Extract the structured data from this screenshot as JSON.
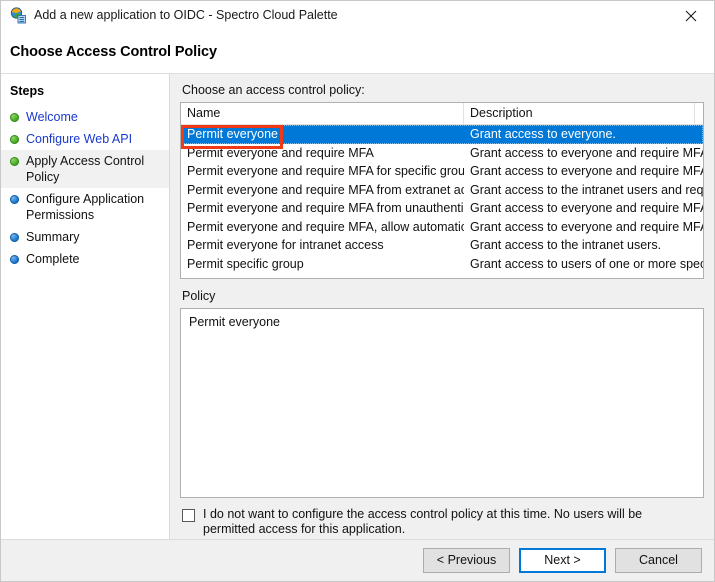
{
  "window": {
    "title": "Add a new application to OIDC - Spectro Cloud Palette",
    "icon": "adfs-wizard-globe-icon",
    "close_label": "×"
  },
  "header": {
    "heading": "Choose Access Control Policy"
  },
  "sidebar": {
    "title": "Steps",
    "items": [
      {
        "label": "Welcome",
        "state": "done",
        "bullet": "green",
        "style": "link"
      },
      {
        "label": "Configure Web API",
        "state": "done",
        "bullet": "green",
        "style": "link"
      },
      {
        "label": "Apply Access Control Policy",
        "state": "current",
        "bullet": "green",
        "style": "plain"
      },
      {
        "label": "Configure Application Permissions",
        "state": "pending",
        "bullet": "blue",
        "style": "plain"
      },
      {
        "label": "Summary",
        "state": "pending",
        "bullet": "blue",
        "style": "plain"
      },
      {
        "label": "Complete",
        "state": "pending",
        "bullet": "blue",
        "style": "plain"
      }
    ]
  },
  "main": {
    "list_label": "Choose an access control policy:",
    "columns": {
      "name": "Name",
      "description": "Description"
    },
    "rows": [
      {
        "name": "Permit everyone",
        "description": "Grant access to everyone.",
        "selected": true
      },
      {
        "name": "Permit everyone and require MFA",
        "description": "Grant access to everyone and require MFA f...",
        "selected": false
      },
      {
        "name": "Permit everyone and require MFA for specific group",
        "description": "Grant access to everyone and require MFA f...",
        "selected": false
      },
      {
        "name": "Permit everyone and require MFA from extranet access",
        "description": "Grant access to the intranet users and requir...",
        "selected": false
      },
      {
        "name": "Permit everyone and require MFA from unauthenticated ...",
        "description": "Grant access to everyone and require MFA f...",
        "selected": false
      },
      {
        "name": "Permit everyone and require MFA, allow automatic devi...",
        "description": "Grant access to everyone and require MFA f...",
        "selected": false
      },
      {
        "name": "Permit everyone for intranet access",
        "description": "Grant access to the intranet users.",
        "selected": false
      },
      {
        "name": "Permit specific group",
        "description": "Grant access to users of one or more specifi...",
        "selected": false
      }
    ],
    "policy_label": "Policy",
    "policy_text": "Permit everyone",
    "checkbox": {
      "checked": false,
      "label": "I do not want to configure the access control policy at this time.  No users will be permitted access for this application."
    }
  },
  "footer": {
    "previous_label": "< Previous",
    "next_label": "Next >",
    "cancel_label": "Cancel"
  },
  "colors": {
    "selection_blue": "#0078d7",
    "annotation_red": "#f03a17",
    "step_link": "#1a39cf",
    "bullet_done": "#44a820",
    "bullet_pending": "#1a72c8",
    "dialog_bg": "#f0f0f0"
  }
}
